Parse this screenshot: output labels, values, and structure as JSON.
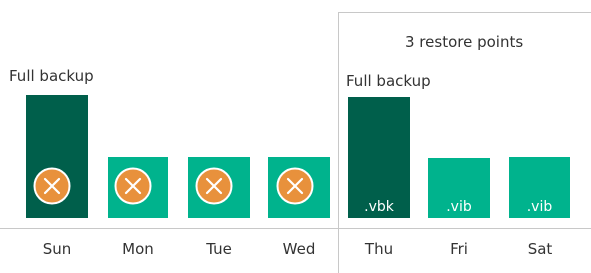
{
  "section": {
    "title": "3 restore points"
  },
  "labels": {
    "full_backup_1": "Full backup",
    "full_backup_2": "Full backup"
  },
  "bars": [
    {
      "day": "Sun",
      "type": "full",
      "state": "removed",
      "ext": ""
    },
    {
      "day": "Mon",
      "type": "incremental",
      "state": "removed",
      "ext": ""
    },
    {
      "day": "Tue",
      "type": "incremental",
      "state": "removed",
      "ext": ""
    },
    {
      "day": "Wed",
      "type": "incremental",
      "state": "removed",
      "ext": ""
    },
    {
      "day": "Thu",
      "type": "full",
      "state": "kept",
      "ext": ".vbk"
    },
    {
      "day": "Fri",
      "type": "incremental",
      "state": "kept",
      "ext": ".vib"
    },
    {
      "day": "Sat",
      "type": "incremental",
      "state": "kept",
      "ext": ".vib"
    }
  ],
  "icons": {
    "removed": "close-circle-icon"
  },
  "colors": {
    "full": "#005f4b",
    "incremental": "#00b38d",
    "removed_marker": "#e8913c"
  }
}
